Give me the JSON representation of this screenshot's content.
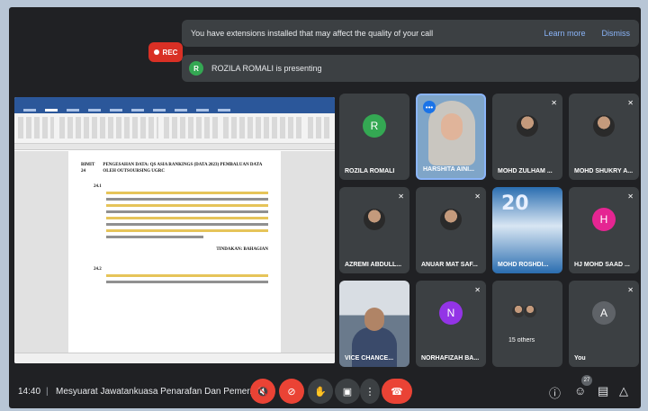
{
  "notifications": {
    "extensions_msg": "You have extensions installed that may affect the quality of your call",
    "learn_more": "Learn more",
    "dismiss": "Dismiss",
    "presenting_initial": "R",
    "presenting_msg": "ROZILA ROMALI is presenting"
  },
  "rec_label": "REC",
  "document": {
    "section_no": "BIMIT 24",
    "section_title": "PENGESAHAN DATA: QS ASIA RANKINGS (DATA 2023) PEMBALUAN DATA OLEH OUTSOURSING UGRC",
    "para_no_1": "24.1",
    "para_no_2": "24.2",
    "tindakan": "TINDAKAN: BAHAGIAN"
  },
  "participants": [
    {
      "name": "ROZILA ROMALI",
      "initial": "R",
      "color": "#34a853"
    },
    {
      "name": "HARSHITA AINI...",
      "initial": "",
      "color": ""
    },
    {
      "name": "MOHD ZULHAM ...",
      "initial": "",
      "color": ""
    },
    {
      "name": "MOHD SHUKRY A...",
      "initial": "",
      "color": ""
    },
    {
      "name": "AZREMI ABDULL...",
      "initial": "",
      "color": ""
    },
    {
      "name": "ANUAR MAT SAF...",
      "initial": "",
      "color": ""
    },
    {
      "name": "MOHD ROSHDI...",
      "initial": "",
      "color": ""
    },
    {
      "name": "HJ MOHD SAAD ...",
      "initial": "H",
      "color": "#e52592"
    },
    {
      "name": "VICE CHANCE...",
      "initial": "",
      "color": ""
    },
    {
      "name": "NORHAFIZAH BA...",
      "initial": "N",
      "color": "#9334e6"
    },
    {
      "name": "15 others",
      "initial": "",
      "color": ""
    },
    {
      "name": "You",
      "initial": "A",
      "color": "#5f6368"
    }
  ],
  "bottom_bar": {
    "time": "14:40",
    "separator": "|",
    "meeting_title": "Mesyuarat Jawatankuasa Penarafan Dan Pemer...",
    "people_count": "27"
  },
  "colors": {
    "accent": "#8ab4f8",
    "danger": "#ea4335",
    "surface": "#3c4043"
  }
}
